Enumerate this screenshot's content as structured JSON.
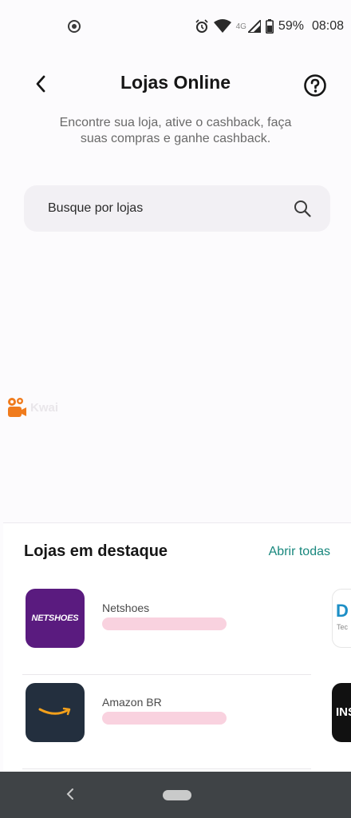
{
  "status_bar": {
    "network": "4G",
    "battery": "59%",
    "time": "08:08"
  },
  "header": {
    "title": "Lojas Online"
  },
  "subtitle": "Encontre sua loja, ative o cashback, faça suas compras e ganhe cashback.",
  "search": {
    "placeholder": "Busque por lojas"
  },
  "watermark": {
    "text": "Kwai"
  },
  "featured": {
    "title": "Lojas em destaque",
    "open_all": "Abrir todas",
    "stores": [
      {
        "name": "Netshoes",
        "logo_text": "NETSHOES",
        "logo_color": "#5a1b7f"
      },
      {
        "name": "Amazon BR",
        "logo_color": "#232f3e"
      }
    ],
    "peek_stores": [
      {
        "logo_text": "D",
        "sub_text": "Tec"
      },
      {
        "logo_text": "INS"
      }
    ]
  },
  "colors": {
    "accent": "#18877d",
    "skeleton": "#f9d2df",
    "nav_bar": "#3f4346"
  }
}
